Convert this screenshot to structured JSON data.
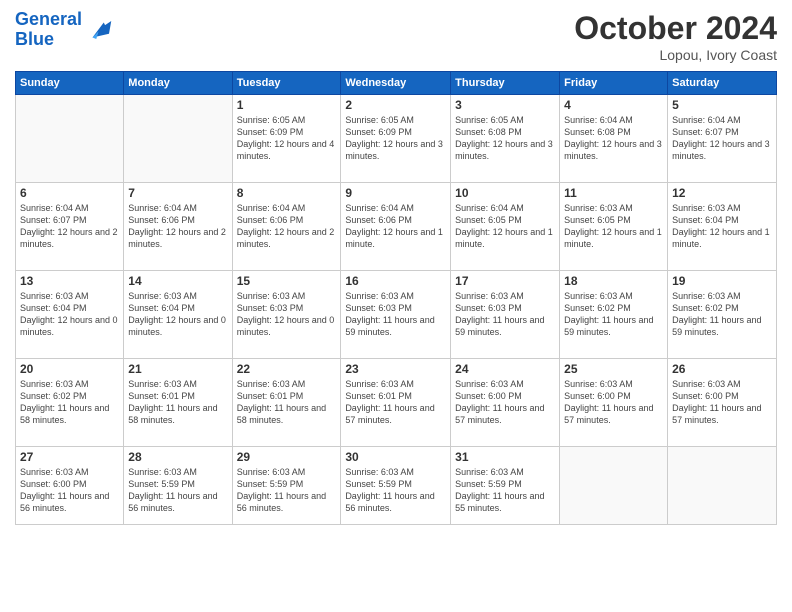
{
  "header": {
    "logo_line1": "General",
    "logo_line2": "Blue",
    "month": "October 2024",
    "location": "Lopou, Ivory Coast"
  },
  "weekdays": [
    "Sunday",
    "Monday",
    "Tuesday",
    "Wednesday",
    "Thursday",
    "Friday",
    "Saturday"
  ],
  "weeks": [
    [
      {
        "day": "",
        "info": ""
      },
      {
        "day": "",
        "info": ""
      },
      {
        "day": "1",
        "info": "Sunrise: 6:05 AM\nSunset: 6:09 PM\nDaylight: 12 hours and 4 minutes."
      },
      {
        "day": "2",
        "info": "Sunrise: 6:05 AM\nSunset: 6:09 PM\nDaylight: 12 hours and 3 minutes."
      },
      {
        "day": "3",
        "info": "Sunrise: 6:05 AM\nSunset: 6:08 PM\nDaylight: 12 hours and 3 minutes."
      },
      {
        "day": "4",
        "info": "Sunrise: 6:04 AM\nSunset: 6:08 PM\nDaylight: 12 hours and 3 minutes."
      },
      {
        "day": "5",
        "info": "Sunrise: 6:04 AM\nSunset: 6:07 PM\nDaylight: 12 hours and 3 minutes."
      }
    ],
    [
      {
        "day": "6",
        "info": "Sunrise: 6:04 AM\nSunset: 6:07 PM\nDaylight: 12 hours and 2 minutes."
      },
      {
        "day": "7",
        "info": "Sunrise: 6:04 AM\nSunset: 6:06 PM\nDaylight: 12 hours and 2 minutes."
      },
      {
        "day": "8",
        "info": "Sunrise: 6:04 AM\nSunset: 6:06 PM\nDaylight: 12 hours and 2 minutes."
      },
      {
        "day": "9",
        "info": "Sunrise: 6:04 AM\nSunset: 6:06 PM\nDaylight: 12 hours and 1 minute."
      },
      {
        "day": "10",
        "info": "Sunrise: 6:04 AM\nSunset: 6:05 PM\nDaylight: 12 hours and 1 minute."
      },
      {
        "day": "11",
        "info": "Sunrise: 6:03 AM\nSunset: 6:05 PM\nDaylight: 12 hours and 1 minute."
      },
      {
        "day": "12",
        "info": "Sunrise: 6:03 AM\nSunset: 6:04 PM\nDaylight: 12 hours and 1 minute."
      }
    ],
    [
      {
        "day": "13",
        "info": "Sunrise: 6:03 AM\nSunset: 6:04 PM\nDaylight: 12 hours and 0 minutes."
      },
      {
        "day": "14",
        "info": "Sunrise: 6:03 AM\nSunset: 6:04 PM\nDaylight: 12 hours and 0 minutes."
      },
      {
        "day": "15",
        "info": "Sunrise: 6:03 AM\nSunset: 6:03 PM\nDaylight: 12 hours and 0 minutes."
      },
      {
        "day": "16",
        "info": "Sunrise: 6:03 AM\nSunset: 6:03 PM\nDaylight: 11 hours and 59 minutes."
      },
      {
        "day": "17",
        "info": "Sunrise: 6:03 AM\nSunset: 6:03 PM\nDaylight: 11 hours and 59 minutes."
      },
      {
        "day": "18",
        "info": "Sunrise: 6:03 AM\nSunset: 6:02 PM\nDaylight: 11 hours and 59 minutes."
      },
      {
        "day": "19",
        "info": "Sunrise: 6:03 AM\nSunset: 6:02 PM\nDaylight: 11 hours and 59 minutes."
      }
    ],
    [
      {
        "day": "20",
        "info": "Sunrise: 6:03 AM\nSunset: 6:02 PM\nDaylight: 11 hours and 58 minutes."
      },
      {
        "day": "21",
        "info": "Sunrise: 6:03 AM\nSunset: 6:01 PM\nDaylight: 11 hours and 58 minutes."
      },
      {
        "day": "22",
        "info": "Sunrise: 6:03 AM\nSunset: 6:01 PM\nDaylight: 11 hours and 58 minutes."
      },
      {
        "day": "23",
        "info": "Sunrise: 6:03 AM\nSunset: 6:01 PM\nDaylight: 11 hours and 57 minutes."
      },
      {
        "day": "24",
        "info": "Sunrise: 6:03 AM\nSunset: 6:00 PM\nDaylight: 11 hours and 57 minutes."
      },
      {
        "day": "25",
        "info": "Sunrise: 6:03 AM\nSunset: 6:00 PM\nDaylight: 11 hours and 57 minutes."
      },
      {
        "day": "26",
        "info": "Sunrise: 6:03 AM\nSunset: 6:00 PM\nDaylight: 11 hours and 57 minutes."
      }
    ],
    [
      {
        "day": "27",
        "info": "Sunrise: 6:03 AM\nSunset: 6:00 PM\nDaylight: 11 hours and 56 minutes."
      },
      {
        "day": "28",
        "info": "Sunrise: 6:03 AM\nSunset: 5:59 PM\nDaylight: 11 hours and 56 minutes."
      },
      {
        "day": "29",
        "info": "Sunrise: 6:03 AM\nSunset: 5:59 PM\nDaylight: 11 hours and 56 minutes."
      },
      {
        "day": "30",
        "info": "Sunrise: 6:03 AM\nSunset: 5:59 PM\nDaylight: 11 hours and 56 minutes."
      },
      {
        "day": "31",
        "info": "Sunrise: 6:03 AM\nSunset: 5:59 PM\nDaylight: 11 hours and 55 minutes."
      },
      {
        "day": "",
        "info": ""
      },
      {
        "day": "",
        "info": ""
      }
    ]
  ]
}
